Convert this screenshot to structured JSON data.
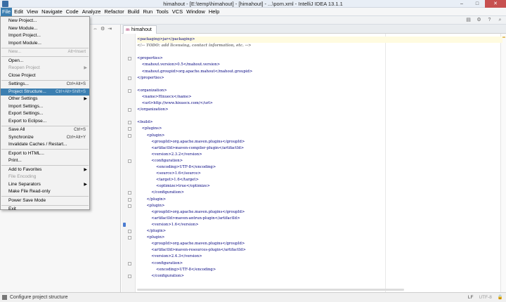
{
  "window": {
    "title": "himahout - [E:\\temp\\himahout] - [himahout] - ...\\pom.xml - IntelliJ IDEA 13.1.1",
    "controls": [
      "minimize",
      "maximize",
      "close"
    ]
  },
  "menubar": [
    "File",
    "Edit",
    "View",
    "Navigate",
    "Code",
    "Analyze",
    "Refactor",
    "Build",
    "Run",
    "Tools",
    "VCS",
    "Window",
    "Help"
  ],
  "file_menu": [
    {
      "label": "New Project...",
      "shortcut": "",
      "disabled": false
    },
    {
      "label": "New Module...",
      "shortcut": "",
      "disabled": false
    },
    {
      "label": "Import Project...",
      "shortcut": "",
      "disabled": false
    },
    {
      "label": "Import Module...",
      "shortcut": "",
      "disabled": false
    },
    {
      "label": "New...",
      "shortcut": "Alt+Insert",
      "disabled": true
    },
    {
      "label": "Open...",
      "shortcut": "",
      "disabled": false
    },
    {
      "label": "Reopen Project",
      "shortcut": "",
      "disabled": true,
      "submenu": true
    },
    {
      "label": "Close Project",
      "shortcut": "",
      "disabled": false
    },
    {
      "label": "Settings...",
      "shortcut": "Ctrl+Alt+S",
      "disabled": false
    },
    {
      "label": "Project Structure...",
      "shortcut": "Ctrl+Alt+Shift+S",
      "disabled": false,
      "selected": true
    },
    {
      "label": "Other Settings",
      "shortcut": "",
      "disabled": false,
      "submenu": true
    },
    {
      "label": "Import Settings...",
      "shortcut": "",
      "disabled": false
    },
    {
      "label": "Export Settings...",
      "shortcut": "",
      "disabled": false
    },
    {
      "label": "Export to Eclipse...",
      "shortcut": "",
      "disabled": false
    },
    {
      "label": "Save All",
      "shortcut": "Ctrl+S",
      "disabled": false
    },
    {
      "label": "Synchronize",
      "shortcut": "Ctrl+Alt+Y",
      "disabled": false
    },
    {
      "label": "Invalidate Caches / Restart...",
      "shortcut": "",
      "disabled": false
    },
    {
      "label": "Export to HTML...",
      "shortcut": "",
      "disabled": false
    },
    {
      "label": "Print...",
      "shortcut": "",
      "disabled": false
    },
    {
      "label": "Add to Favorites",
      "shortcut": "",
      "disabled": false,
      "submenu": true
    },
    {
      "label": "File Encoding",
      "shortcut": "",
      "disabled": true
    },
    {
      "label": "Line Separators",
      "shortcut": "",
      "disabled": false,
      "submenu": true
    },
    {
      "label": "Make File Read-only",
      "shortcut": "",
      "disabled": false
    },
    {
      "label": "Power Save Mode",
      "shortcut": "",
      "disabled": false
    },
    {
      "label": "Exit",
      "shortcut": "",
      "disabled": false
    }
  ],
  "editor": {
    "tab_label": "himahout",
    "lines": [
      "<packaging>jar</packaging>",
      "<!-- TODO: add licensing, contact information, etc. -->",
      "",
      "<properties>",
      "    <mahout.version>0.5</mahout.version>",
      "    <mahout.groupid>org.apache.mahout</mahout.groupid>",
      "</properties>",
      "",
      "<organization>",
      "    <name>Hixuecx</name>",
      "    <url>http://www.hixuecx.com/</url>",
      "</organization>",
      "",
      "<build>",
      "    <plugins>",
      "        <plugin>",
      "            <groupId>org.apache.maven.plugins</groupId>",
      "            <artifactId>maven-compiler-plugin</artifactId>",
      "            <version>2.3.2</version>",
      "            <configuration>",
      "                <encoding>UTF-8</encoding>",
      "                <source>1.6</source>",
      "                <target>1.6</target>",
      "                <optimize>true</optimize>",
      "            </configuration>",
      "        </plugin>",
      "        <plugin>",
      "            <groupId>org.apache.maven.plugins</groupId>",
      "            <artifactId>maven-antrun-plugin</artifactId>",
      "            <version>1.6</version>",
      "        </plugin>",
      "        <plugin>",
      "            <groupId>org.apache.maven.plugins</groupId>",
      "            <artifactId>maven-resources-plugin</artifactId>",
      "            <version>2.4.3</version>",
      "            <configuration>",
      "                <encoding>UTF-8</encoding>",
      "            </configuration>"
    ]
  },
  "statusbar": {
    "message": "Configure project structure",
    "line_separator": "LF",
    "encoding": "UTF-8"
  },
  "colors": {
    "menu_selection": "#3c7fb1",
    "xml_tag": "#00007f",
    "comment": "#7a7a7a"
  }
}
